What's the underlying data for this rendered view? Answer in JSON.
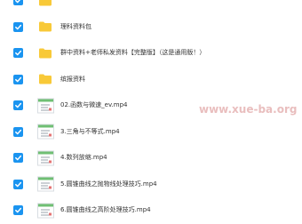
{
  "file_list": [
    {
      "type": "folder",
      "name": "",
      "checked": true
    },
    {
      "type": "folder",
      "name": "理科资料包",
      "checked": true
    },
    {
      "type": "folder",
      "name": "群中资料+老师私发资料【完整版】（这是通用版！）",
      "checked": true
    },
    {
      "type": "folder",
      "name": "缤报资料",
      "checked": true
    },
    {
      "type": "video",
      "name": "02.函数与微速_ev.mp4",
      "checked": true
    },
    {
      "type": "video",
      "name": "3.三角与不等式.mp4",
      "checked": true
    },
    {
      "type": "video",
      "name": "4.数列放缩.mp4",
      "checked": true
    },
    {
      "type": "video",
      "name": "5.圆锥曲线之抛物线处理技巧.mp4",
      "checked": true
    },
    {
      "type": "video",
      "name": "6.圆锥曲线之高阶处理技巧.mp4",
      "checked": true
    }
  ],
  "watermark": "www.xue-ba.org",
  "colors": {
    "checkbox": "#1a94f0",
    "folder": "#f8c938",
    "text": "#333333"
  }
}
